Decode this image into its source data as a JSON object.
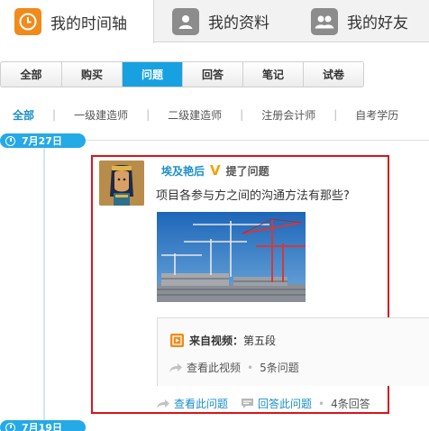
{
  "top_tabs": [
    {
      "label": "我的时间轴",
      "icon": "clock-icon",
      "active": true
    },
    {
      "label": "我的资料",
      "icon": "user-profile-icon",
      "active": false
    },
    {
      "label": "我的好友",
      "icon": "friends-icon",
      "active": false
    }
  ],
  "filters": [
    "全部",
    "购买",
    "问题",
    "回答",
    "笔记",
    "试卷"
  ],
  "active_filter": "问题",
  "sub_filters": [
    "全部",
    "一级建造师",
    "二级建造师",
    "注册会计师",
    "自考学历"
  ],
  "active_sub_filter": "全部",
  "timeline": {
    "date_1": "7月27日",
    "date_2": "7月19日"
  },
  "card": {
    "author": "埃及艳后",
    "action": "提了问题",
    "question": "项目各参与方之间的沟通方法有那些?",
    "source_label": "来自视频：",
    "source_value": "第五段",
    "view_video": "查看此视频",
    "video_question_count": "5条问题",
    "view_question": "查看此问题",
    "answer_question": "回答此问题",
    "answer_count": "4条回答"
  },
  "colors": {
    "accent": "#25a9e7",
    "orange": "#f08a1a",
    "highlight_border": "#d9141a"
  }
}
